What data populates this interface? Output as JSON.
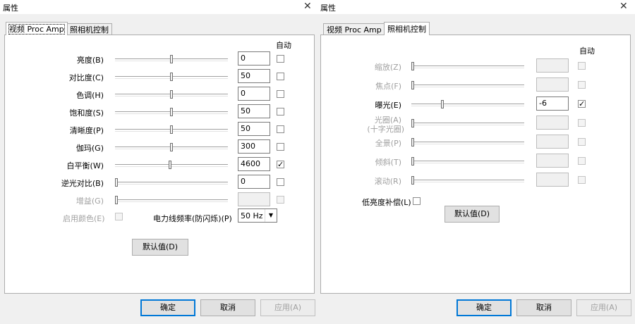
{
  "left": {
    "title": "属性",
    "close_glyph": "✕",
    "tabs": [
      "视频 Proc Amp",
      "照相机控制"
    ],
    "auto_label": "自动",
    "rows": [
      {
        "label": "亮度(B)",
        "value": "0",
        "position": 0.5,
        "auto": false,
        "enabled": true
      },
      {
        "label": "对比度(C)",
        "value": "50",
        "position": 0.5,
        "auto": false,
        "enabled": true
      },
      {
        "label": "色调(H)",
        "value": "0",
        "position": 0.5,
        "auto": false,
        "enabled": true
      },
      {
        "label": "饱和度(S)",
        "value": "50",
        "position": 0.5,
        "auto": false,
        "enabled": true
      },
      {
        "label": "清晰度(P)",
        "value": "50",
        "position": 0.5,
        "auto": false,
        "enabled": true
      },
      {
        "label": "伽玛(G)",
        "value": "300",
        "position": 0.5,
        "auto": false,
        "enabled": true
      },
      {
        "label": "白平衡(W)",
        "value": "4600",
        "position": 0.49,
        "auto": true,
        "enabled": true
      },
      {
        "label": "逆光对比(B)",
        "value": "0",
        "position": 0.0,
        "auto": false,
        "enabled": true
      },
      {
        "label": "增益(G)",
        "value": "",
        "position": 0.0,
        "auto": false,
        "enabled": false
      }
    ],
    "color_enable_label": "启用颜色(E)",
    "freq_label": "电力线频率(防闪烁)(P)",
    "freq_value": "50 Hz",
    "default_button": "默认值(D)",
    "ok": "确定",
    "cancel": "取消",
    "apply": "应用(A)"
  },
  "right": {
    "title": "属性",
    "close_glyph": "✕",
    "tabs": [
      "视频 Proc Amp",
      "照相机控制"
    ],
    "auto_label": "自动",
    "rows": [
      {
        "label": "缩放(Z)",
        "value": "",
        "position": 0.0,
        "auto": false,
        "enabled": false
      },
      {
        "label": "焦点(F)",
        "value": "",
        "position": 0.0,
        "auto": false,
        "enabled": false
      },
      {
        "label": "曝光(E)",
        "value": "-6",
        "position": 0.27,
        "auto": true,
        "enabled": true
      },
      {
        "label": "光圈(A)",
        "label2": "(十字光圈)",
        "value": "",
        "position": 0.0,
        "auto": false,
        "enabled": false
      },
      {
        "label": "全景(P)",
        "value": "",
        "position": 0.0,
        "auto": false,
        "enabled": false
      },
      {
        "label": "倾斜(T)",
        "value": "",
        "position": 0.0,
        "auto": false,
        "enabled": false
      },
      {
        "label": "滚动(R)",
        "value": "",
        "position": 0.0,
        "auto": false,
        "enabled": false
      }
    ],
    "low_light_label": "低亮度补偿(L)",
    "default_button": "默认值(D)",
    "ok": "确定",
    "cancel": "取消",
    "apply": "应用(A)"
  }
}
